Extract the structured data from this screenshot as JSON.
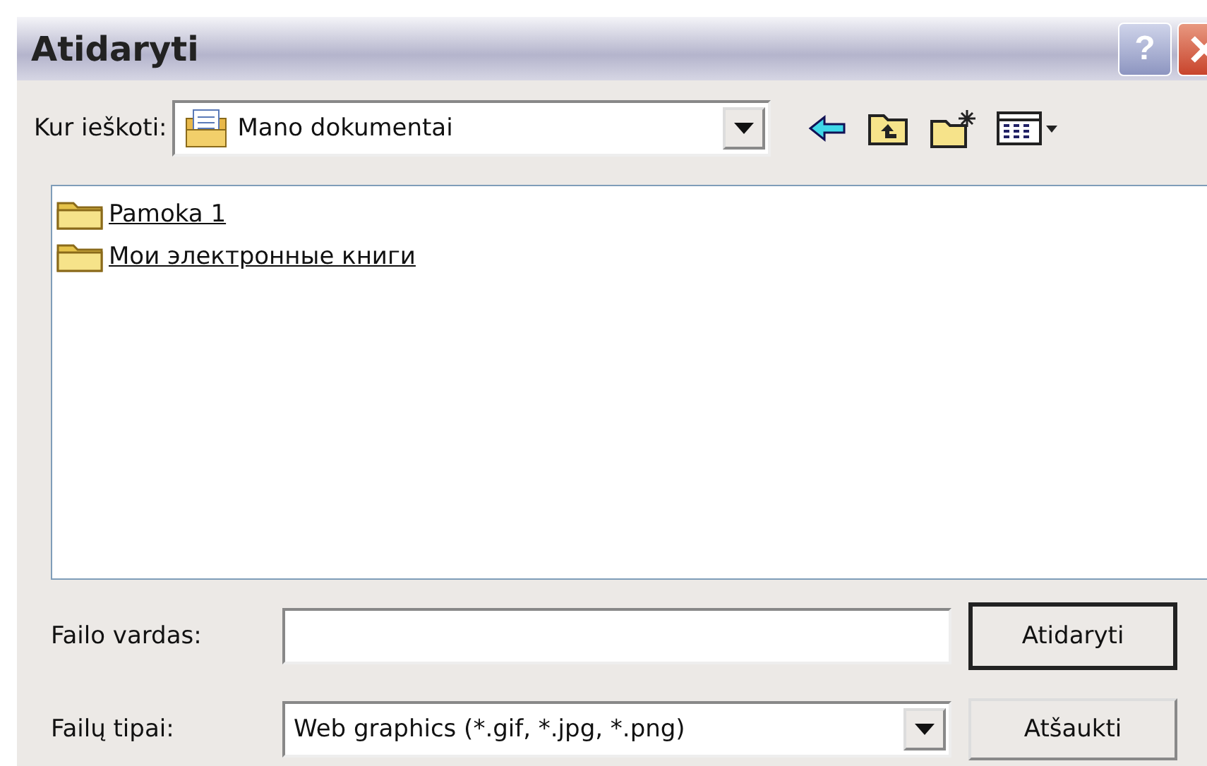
{
  "window": {
    "title": "Atidaryti"
  },
  "title_buttons": [
    {
      "kind": "help",
      "label": "?"
    },
    {
      "kind": "close"
    }
  ],
  "look_in": {
    "label": "Kur ieškoti:",
    "value": "Mano dokumentai"
  },
  "toolbar": [
    {
      "kind": "back"
    },
    {
      "kind": "up"
    },
    {
      "kind": "new-folder"
    },
    {
      "kind": "views"
    }
  ],
  "files": [
    {
      "name": "Pamoka 1"
    },
    {
      "name": "Мои электронные книги"
    }
  ],
  "file_name": {
    "label": "Failo vardas:"
  },
  "file_type": {
    "label": "Failų tipai:",
    "value": "Web graphics (*.gif, *.jpg, *.png)"
  },
  "buttons": [
    {
      "label": "Atidaryti",
      "default": true
    },
    {
      "label": "Atšaukti",
      "default": false
    }
  ]
}
